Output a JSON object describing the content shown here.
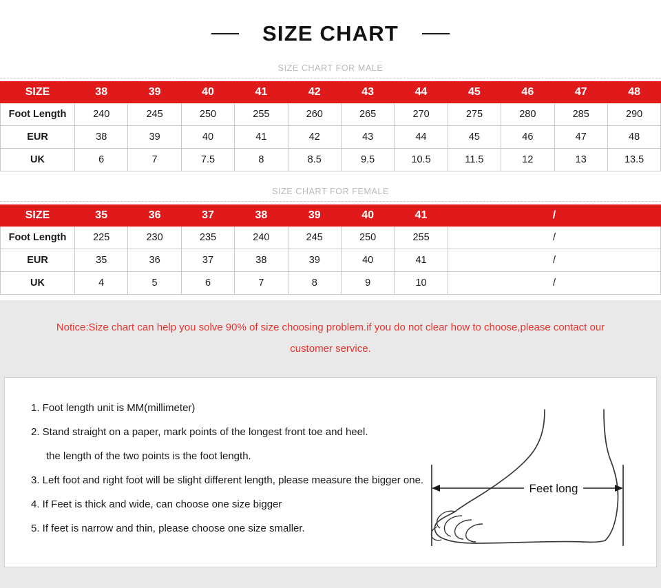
{
  "header": {
    "title": "SIZE CHART",
    "left_dash": "dash",
    "right_dash": "dash"
  },
  "male_section": {
    "label": "SIZE CHART FOR MALE",
    "row_headers": [
      "SIZE",
      "Foot Length",
      "EUR",
      "UK"
    ],
    "sizes": [
      "38",
      "39",
      "40",
      "41",
      "42",
      "43",
      "44",
      "45",
      "46",
      "47",
      "48"
    ],
    "foot_length": [
      "240",
      "245",
      "250",
      "255",
      "260",
      "265",
      "270",
      "275",
      "280",
      "285",
      "290"
    ],
    "eur": [
      "38",
      "39",
      "40",
      "41",
      "42",
      "43",
      "44",
      "45",
      "46",
      "47",
      "48"
    ],
    "uk": [
      "6",
      "7",
      "7.5",
      "8",
      "8.5",
      "9.5",
      "10.5",
      "11.5",
      "12",
      "13",
      "13.5"
    ]
  },
  "female_section": {
    "label": "SIZE CHART FOR FEMALE",
    "row_headers": [
      "SIZE",
      "Foot Length",
      "EUR",
      "UK"
    ],
    "sizes": [
      "35",
      "36",
      "37",
      "38",
      "39",
      "40",
      "41"
    ],
    "empty_marker": "/",
    "foot_length": [
      "225",
      "230",
      "235",
      "240",
      "245",
      "250",
      "255"
    ],
    "eur": [
      "35",
      "36",
      "37",
      "38",
      "39",
      "40",
      "41"
    ],
    "uk": [
      "4",
      "5",
      "6",
      "7",
      "8",
      "9",
      "10"
    ]
  },
  "notice": {
    "line1": "Notice:Size chart can help you solve 90% of size choosing problem.if you do not clear how to choose,please contact our",
    "line2": "customer service."
  },
  "instructions": {
    "steps": [
      "1. Foot length unit is MM(millimeter)",
      "2. Stand straight on a paper, mark points of the longest front toe and heel.",
      "the length of the two points is the foot length.",
      "3. Left foot and right foot will be slight different length, please measure the bigger one.",
      "4. If Feet is thick and wide, can choose one size bigger",
      "5. If feet is narrow and thin, please choose one size smaller."
    ]
  },
  "diagram": {
    "measure_label": "Feet long"
  },
  "colors": {
    "header_red": "#e01a1a",
    "notice_red": "#e8332f",
    "band_gray": "#e9e9e9",
    "border_gray": "#c8c8c8",
    "label_gray": "#b9b9b9"
  }
}
